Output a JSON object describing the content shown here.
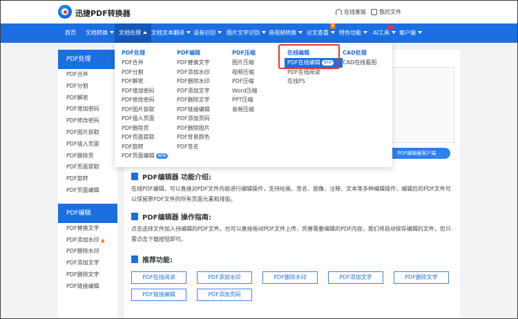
{
  "header": {
    "brand": "迅捷PDF转换器",
    "service_link": "在线客服",
    "my_files_link": "我的文件"
  },
  "nav": {
    "items": [
      "首页",
      "文档转换",
      "文档处理",
      "文档文本翻译",
      "语音识别",
      "图片文字识别",
      "音视频转换",
      "论文查重",
      "特色功能",
      "AI工具",
      "客户端"
    ],
    "hot_badge": "新"
  },
  "sidebar": {
    "section1_title": "PDF处理",
    "section1_items": [
      "PDF合并",
      "PDF分割",
      "PDF解密",
      "PDF增加密码",
      "PDF修改密码",
      "PDF图片获取",
      "PDF插入页面",
      "PDF删除页",
      "PDF页面提取",
      "PDF旋转",
      "PDF页面编辑"
    ],
    "section2_title": "PDF编辑",
    "section2_items": [
      "PDF替换文字",
      "PDF添加水印",
      "PDF删除水印",
      "PDF添加文字",
      "PDF删除文字",
      "PDF链接编辑"
    ]
  },
  "dropdown": {
    "col1": {
      "title": "PDF处理",
      "items": [
        "PDF合并",
        "PDF分割",
        "PDF解密",
        "PDF增加密码",
        "PDF修改密码",
        "PDF图片获取",
        "PDF插入页面",
        "PDF删除页",
        "PDF页面提取",
        "PDF旋转",
        "PDF页面编辑"
      ]
    },
    "col2": {
      "title": "PDF编辑",
      "items": [
        "PDF替换文字",
        "PDF添加水印",
        "PDF删除水印",
        "PDF添加文字",
        "PDF删除文字",
        "PDF链接编辑",
        "PDF添加页码",
        "PDF删除图片",
        "PDF背景颜色",
        "PDF签名"
      ]
    },
    "col3": {
      "title": "PDF压缩",
      "items": [
        "图片压缩",
        "视频压缩",
        "PDF压缩",
        "Word压缩",
        "PPT压缩",
        "音频压缩"
      ]
    },
    "col4": {
      "title": "在线编辑",
      "items": [
        "PDF在线编辑",
        "PDF在线阅读",
        "在线PS"
      ]
    },
    "col5": {
      "title": "CAD处理",
      "items": [
        "CAD在线看图"
      ]
    },
    "new_tag": "NEW"
  },
  "main": {
    "client_button": "PDF编辑器客户端",
    "intro_title": "PDF编辑器 功能介绍:",
    "intro_text": "在线PDF编辑，可以直接对PDF文件内容进行编辑操作，支持绘画、签名、图像、注释、文本等多种编辑操作，编辑后的PDF文件可以保留原PDF文件的所有页面元素和排版。",
    "guide_title": "PDF编辑器 操作指南:",
    "guide_text": "点击选择文件加入待编辑的PDF文件。也可以直接拖动PDF文件上传，完善需要编辑的PDF内容，我们将自动保存编辑的文件，您只需点击下载按钮即可。",
    "rec_title": "推荐功能:",
    "features": [
      "PDF在线阅读",
      "PDF添加水印",
      "PDF删除水印",
      "PDF添加文字",
      "PDF删除文字",
      "PDF链接编辑",
      "PDF添加页码"
    ]
  },
  "colors": {
    "brand_blue": "#1c6fe0",
    "highlight_red": "#e8322a"
  }
}
